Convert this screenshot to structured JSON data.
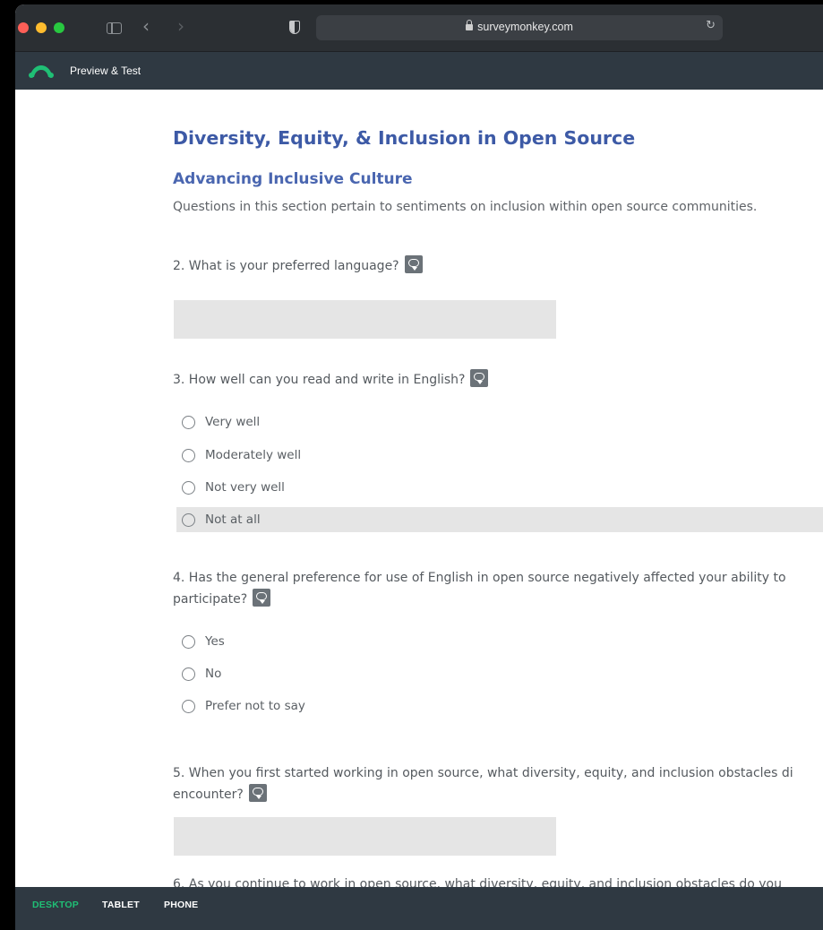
{
  "browser": {
    "url": "surveymonkey.com"
  },
  "app": {
    "title": "Preview & Test",
    "accent": "#1fbf75"
  },
  "survey": {
    "title": "Diversity, Equity, & Inclusion in Open Source",
    "page_title": "Advancing Inclusive Culture",
    "page_description": "Questions in this section pertain to sentiments on inclusion within open source communities.",
    "questions": [
      {
        "text": "2. What is your preferred language?",
        "type": "text",
        "value": ""
      },
      {
        "text": "3. How well can you read and write in English?",
        "type": "radio",
        "options": [
          "Very well",
          "Moderately well",
          "Not very well",
          "Not at all"
        ],
        "hovered_option": "Not at all"
      },
      {
        "text_line1": "4. Has the general preference for use of English in open source negatively affected your ability to",
        "text_line2": "participate?",
        "type": "radio",
        "options": [
          "Yes",
          "No",
          "Prefer not to say"
        ]
      },
      {
        "text_line1": "5. When you first started working in open source, what diversity, equity, and inclusion obstacles di",
        "text_line2": "encounter?",
        "type": "text",
        "value": ""
      },
      {
        "text_line1": "6. As you continue to work in open source, what diversity, equity, and inclusion obstacles do you"
      }
    ]
  },
  "footer": {
    "tabs": [
      "DESKTOP",
      "TABLET",
      "PHONE"
    ],
    "active_tab": "DESKTOP"
  }
}
